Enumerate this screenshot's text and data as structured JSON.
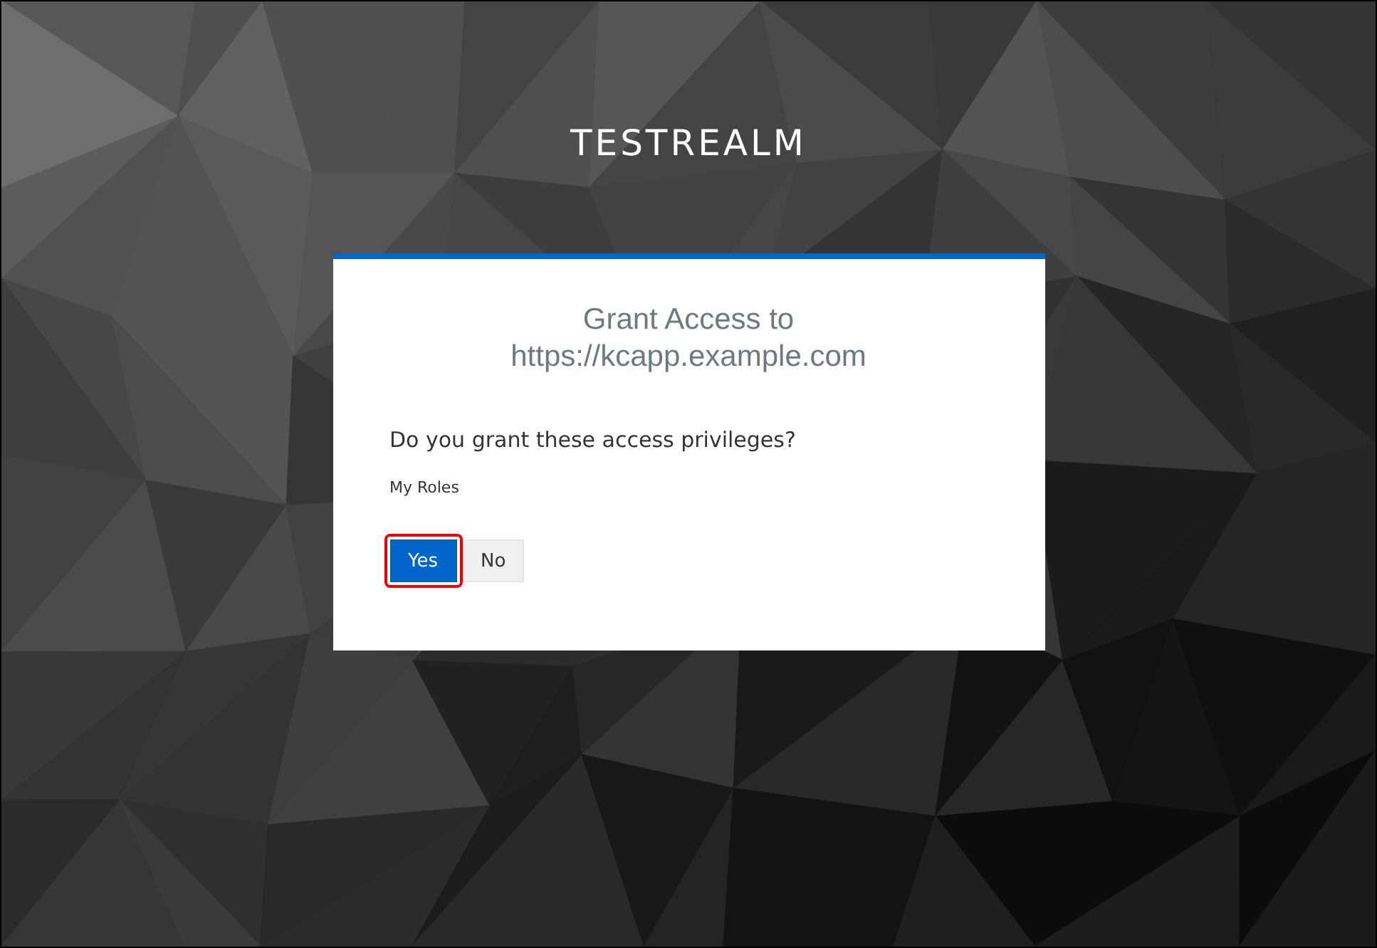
{
  "realm_title": "TESTREALM",
  "card": {
    "heading_lines": [
      "Grant Access to",
      "https://kcapp.example.com"
    ],
    "question": "Do you grant these access privileges?",
    "scopes": [
      "My Roles"
    ],
    "buttons": [
      {
        "label": "Yes",
        "kind": "primary",
        "highlighted": true
      },
      {
        "label": "No",
        "kind": "secondary",
        "highlighted": false
      }
    ]
  }
}
